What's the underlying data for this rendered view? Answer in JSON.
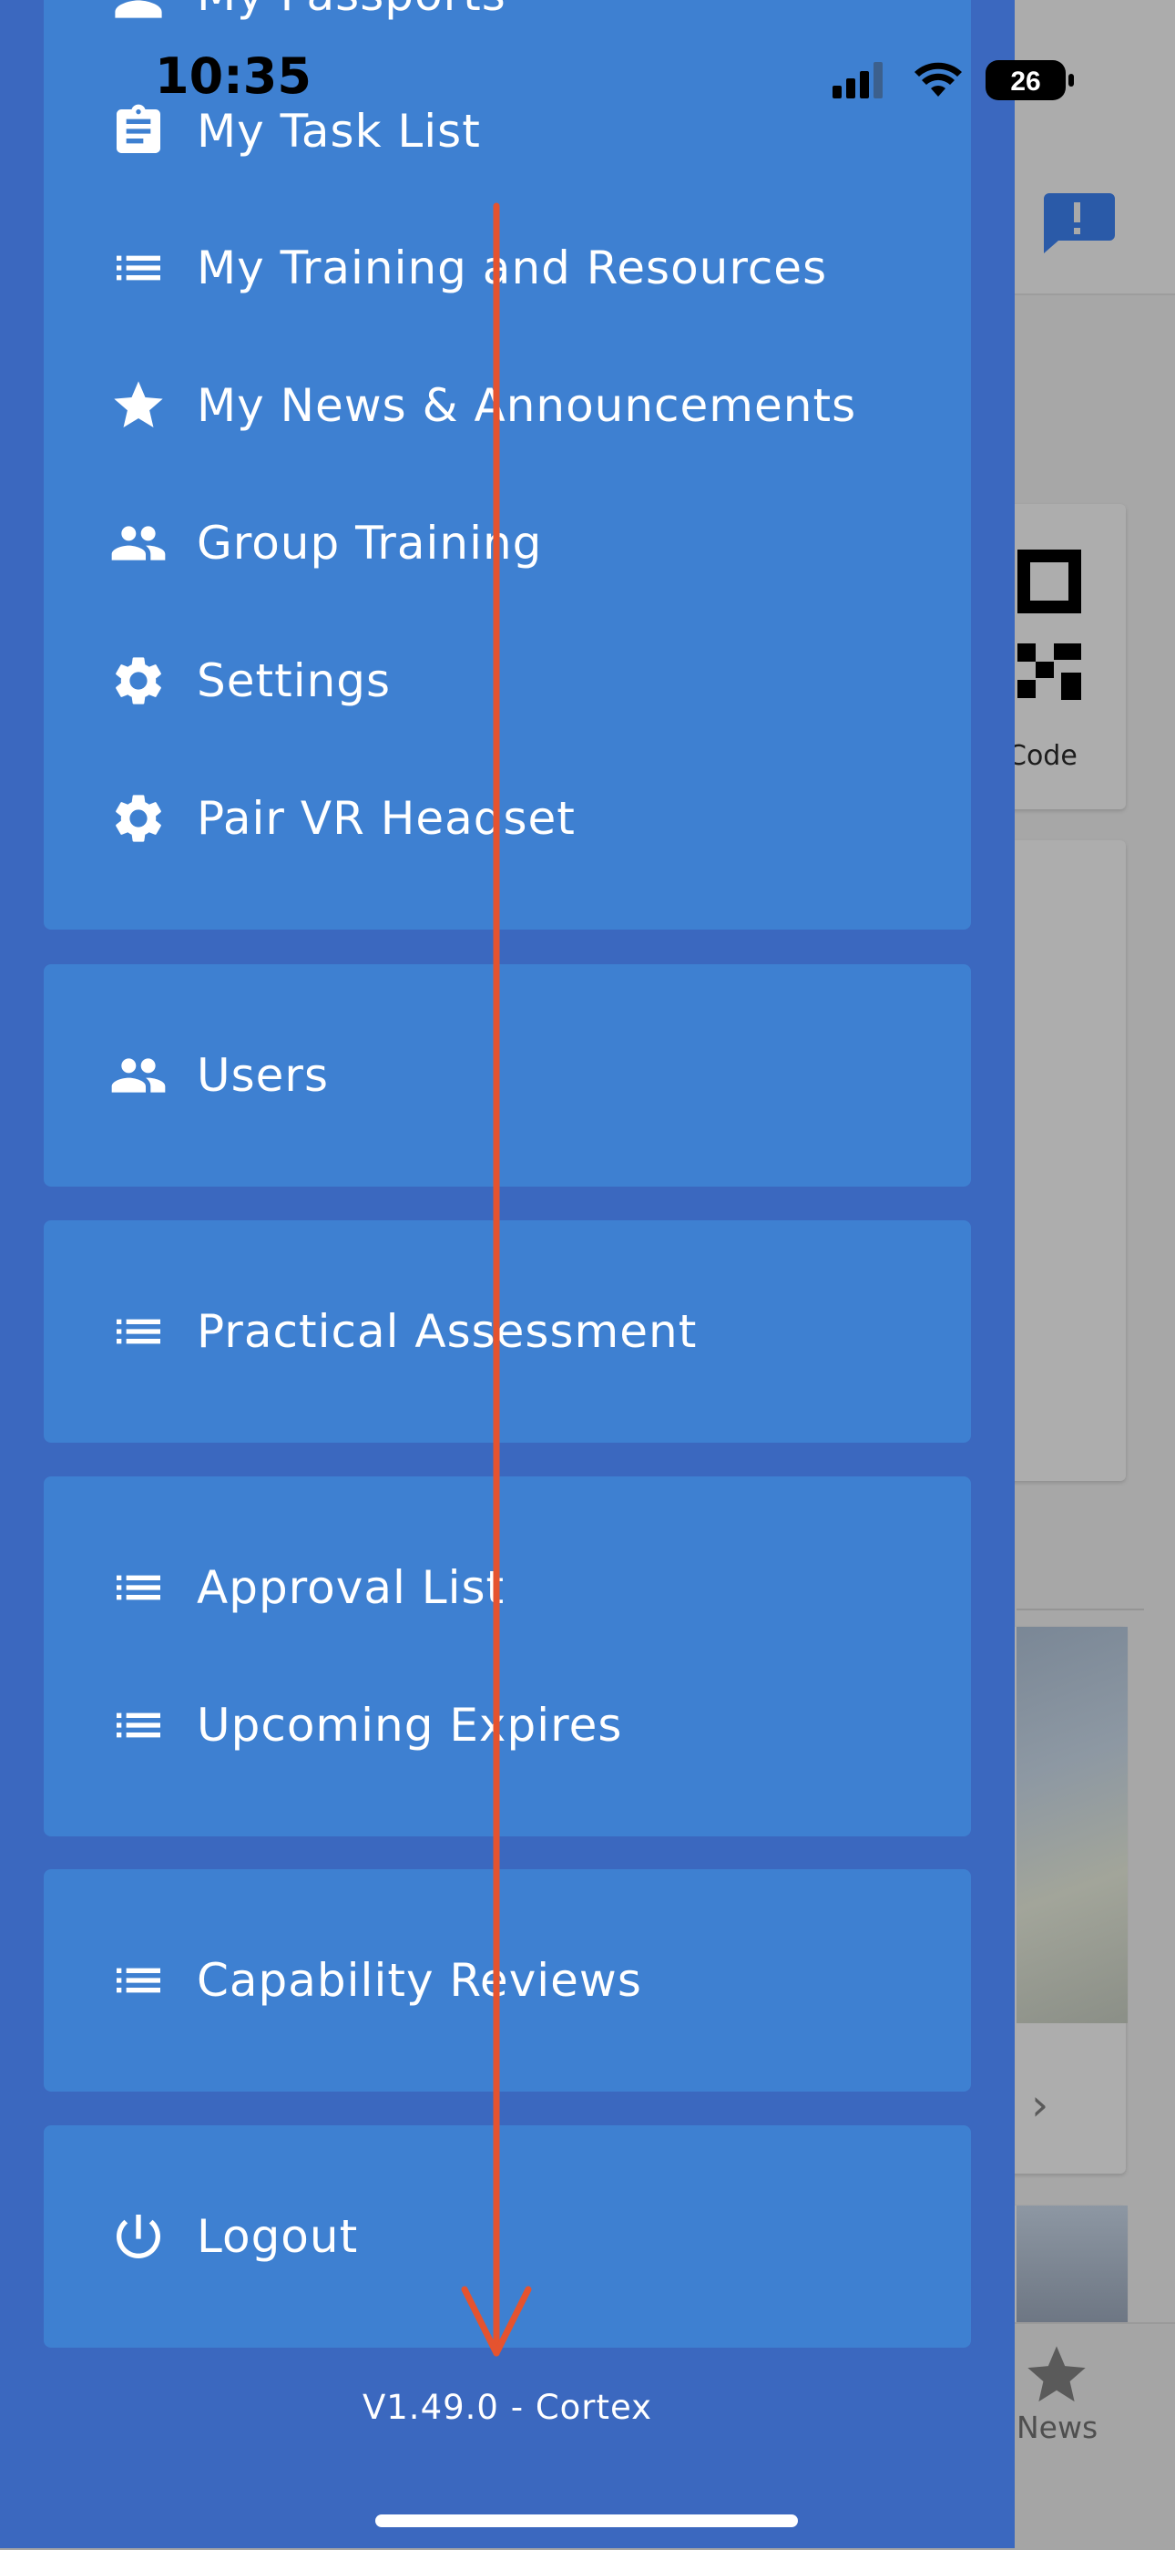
{
  "status_bar": {
    "time": "10:35",
    "battery": "26"
  },
  "drawer": {
    "sections": [
      {
        "items": [
          {
            "label": "My Passports",
            "icon": "person-icon"
          },
          {
            "label": "My Task List",
            "icon": "clipboard-icon"
          },
          {
            "label": "My Training and Resources",
            "icon": "list-icon"
          },
          {
            "label": "My News & Announcements",
            "icon": "star-icon"
          },
          {
            "label": "Group Training",
            "icon": "group-icon"
          },
          {
            "label": "Settings",
            "icon": "gear-icon"
          },
          {
            "label": "Pair VR Headset",
            "icon": "gear-icon"
          }
        ]
      },
      {
        "items": [
          {
            "label": "Users",
            "icon": "group-icon"
          }
        ]
      },
      {
        "items": [
          {
            "label": "Practical Assessment",
            "icon": "list-icon"
          }
        ]
      },
      {
        "items": [
          {
            "label": "Approval List",
            "icon": "list-icon"
          },
          {
            "label": "Upcoming Expires",
            "icon": "list-icon"
          }
        ]
      },
      {
        "items": [
          {
            "label": "Capability Reviews",
            "icon": "list-icon"
          }
        ]
      },
      {
        "items": [
          {
            "label": "Logout",
            "icon": "power-icon"
          }
        ]
      }
    ],
    "version": "V1.49.0 - Cortex"
  },
  "background": {
    "qr_label": "Code",
    "news_label": "News"
  },
  "colors": {
    "drawer_bg": "#3b68bf",
    "card_bg": "#3e80d1",
    "swipe_arrow": "#e5532f"
  }
}
